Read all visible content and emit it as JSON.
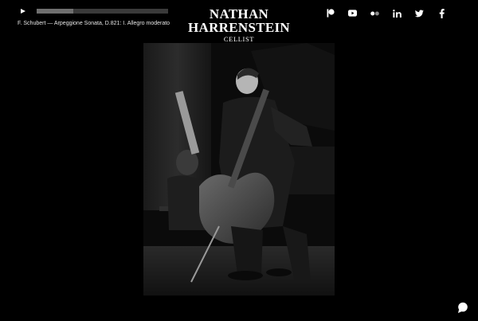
{
  "player": {
    "now_playing": "F. Schubert — Arpeggione Sonata, D.821: I. Allegro moderato",
    "progress": 0.28,
    "play_icon": "play-icon"
  },
  "header": {
    "name_line1": "NATHAN",
    "name_line2": "HARRENSTEIN",
    "subtitle": "CELLIST"
  },
  "social": [
    {
      "name": "patreon-icon"
    },
    {
      "name": "youtube-icon"
    },
    {
      "name": "flickr-icon"
    },
    {
      "name": "linkedin-icon"
    },
    {
      "name": "twitter-icon"
    },
    {
      "name": "facebook-icon"
    }
  ],
  "photo": {
    "subject": "cellist-and-pianist-photo"
  },
  "chat": {
    "icon": "chat-icon"
  },
  "colors": {
    "background": "#000000",
    "text": "#ffffff",
    "track": "#3a3a3a",
    "fill": "#6f6f6f"
  }
}
